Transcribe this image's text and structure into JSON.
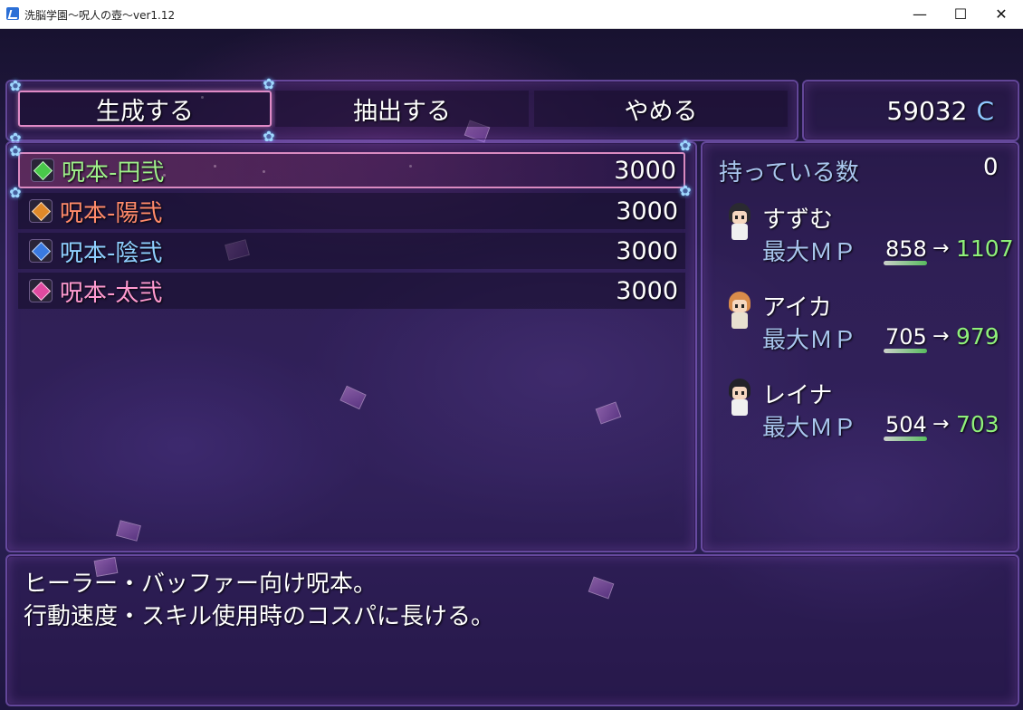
{
  "window": {
    "title": "洗脳学園～呪人の壺～ver1.12",
    "controls": {
      "minimize": "—",
      "maximize": "☐",
      "close": "✕"
    }
  },
  "commands": [
    {
      "label": "生成する",
      "selected": true
    },
    {
      "label": "抽出する",
      "selected": false
    },
    {
      "label": "やめる",
      "selected": false
    }
  ],
  "gold": {
    "amount": "59032",
    "unit": "C"
  },
  "items": [
    {
      "name": "呪本-円弐",
      "price": "3000",
      "color": "#9ff08a",
      "icon": "green-book-icon",
      "gem": "#49c84a",
      "selected": true
    },
    {
      "name": "呪本-陽弐",
      "price": "3000",
      "color": "#ff8a6a",
      "icon": "orange-book-icon",
      "gem": "#e0892a",
      "selected": false
    },
    {
      "name": "呪本-陰弐",
      "price": "3000",
      "color": "#8fd0ff",
      "icon": "blue-book-icon",
      "gem": "#3a7ae0",
      "selected": false
    },
    {
      "name": "呪本-太弐",
      "price": "3000",
      "color": "#ff9ad0",
      "icon": "pink-book-icon",
      "gem": "#e04aa0",
      "selected": false
    }
  ],
  "status": {
    "possession_label": "持っている数",
    "possession_count": "0",
    "stat_label": "最大ＭＰ",
    "arrow": "→",
    "actors": [
      {
        "name": "すずむ",
        "old": "858",
        "new": "1107",
        "hair": "#2a2a30",
        "body": "#f0f0f0"
      },
      {
        "name": "アイカ",
        "old": "705",
        "new": "979",
        "hair": "#d98b4a",
        "body": "#e8e0d0"
      },
      {
        "name": "レイナ",
        "old": "504",
        "new": "703",
        "hair": "#222228",
        "body": "#f0f0f0"
      }
    ]
  },
  "help": {
    "line1": "ヒーラー・バッファー向け呪本。",
    "line2": "行動速度・スキル使用時のコスパに長ける。"
  }
}
